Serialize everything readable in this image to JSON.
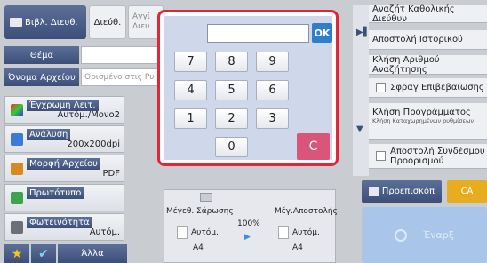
{
  "tabs": {
    "address_book": "Βιβλ. Διευθ.",
    "destination": "Διεύθ.",
    "global_search": "Αγγί Διευ"
  },
  "fields": {
    "subject_label": "Θέμα",
    "subject_value": "",
    "filename_label": "Όνομα Αρχείου",
    "filename_placeholder": "Ορισμένο στις Ρυ"
  },
  "settings": [
    {
      "name": "Έγχρωμη Λειτ.",
      "value": "Αυτόμ./Mονο2"
    },
    {
      "name": "Ανάλυση",
      "value": "200x200dpi"
    },
    {
      "name": "Μορφή Αρχείου",
      "value": "PDF"
    },
    {
      "name": "Πρωτότυπο",
      "value": ""
    },
    {
      "name": "Φωτεινότητα",
      "value": "Αυτόμ."
    }
  ],
  "bottom_bar": {
    "others_label": "Άλλα"
  },
  "keypad": {
    "display_value": "",
    "ok_label": "OK",
    "keys": [
      "7",
      "8",
      "9",
      "4",
      "5",
      "6",
      "1",
      "2",
      "3",
      "0"
    ],
    "clear_label": "C"
  },
  "scan": {
    "scan_size_label": "Μέγεθ. Σάρωσης",
    "send_size_label": "Μέγ.Αποστολής",
    "ratio": "100%",
    "scan_auto": "Αυτόμ.",
    "scan_paper": "A4",
    "send_auto": "Αυτόμ.",
    "send_paper": "A4"
  },
  "right_panel": {
    "global_search": "Αναζήτ Καθολικής Διεύθυν",
    "send_history": "Αποστολή Ιστορικού",
    "call_search_number": "Κλήση Αριθμού Αναζήτησης",
    "verify_stamp": "Σφραγ Επιβεβαίωσης",
    "call_program": "Κλήση Προγράμματος",
    "call_program_sub": "Κλήση Καταχωρημένων ρυθμίσεων",
    "send_link": "Αποστολή Συνδέσμου Προορισμού"
  },
  "actions": {
    "preview": "Προεπισκόπ",
    "ca": "CA",
    "start": "Έναρξ"
  },
  "colors": {
    "accent_red": "#e3243b",
    "ok_blue": "#2d7fcc",
    "clear_pink": "#d9567a",
    "ca_orange": "#e8ad1e"
  }
}
